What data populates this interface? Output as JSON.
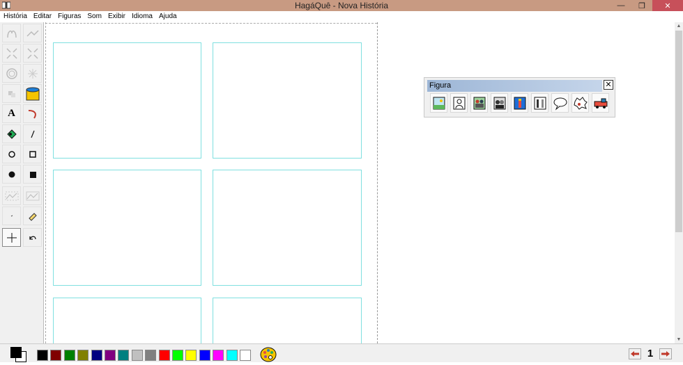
{
  "window": {
    "title": "HagáQuê - Nova História"
  },
  "menu": [
    "História",
    "Editar",
    "Figuras",
    "Som",
    "Exibir",
    "Idioma",
    "Ajuda"
  ],
  "float_toolbar": {
    "title": "Figura",
    "close_label": "✕",
    "icons": [
      "scene-icon",
      "person-icon",
      "group-icon",
      "character-icon",
      "bottle-icon",
      "objects-icon",
      "speech-balloon-icon",
      "sound-effect-icon",
      "vehicle-icon"
    ]
  },
  "palette": {
    "primary": "#000000",
    "secondary": "#ffffff",
    "colors": [
      "#000000",
      "#800000",
      "#008000",
      "#808000",
      "#000080",
      "#800080",
      "#008080",
      "#c0c0c0",
      "#808080",
      "#ff0000",
      "#00ff00",
      "#ffff00",
      "#0000ff",
      "#ff00ff",
      "#00ffff",
      "#ffffff"
    ]
  },
  "page_nav": {
    "page_number": "1"
  }
}
